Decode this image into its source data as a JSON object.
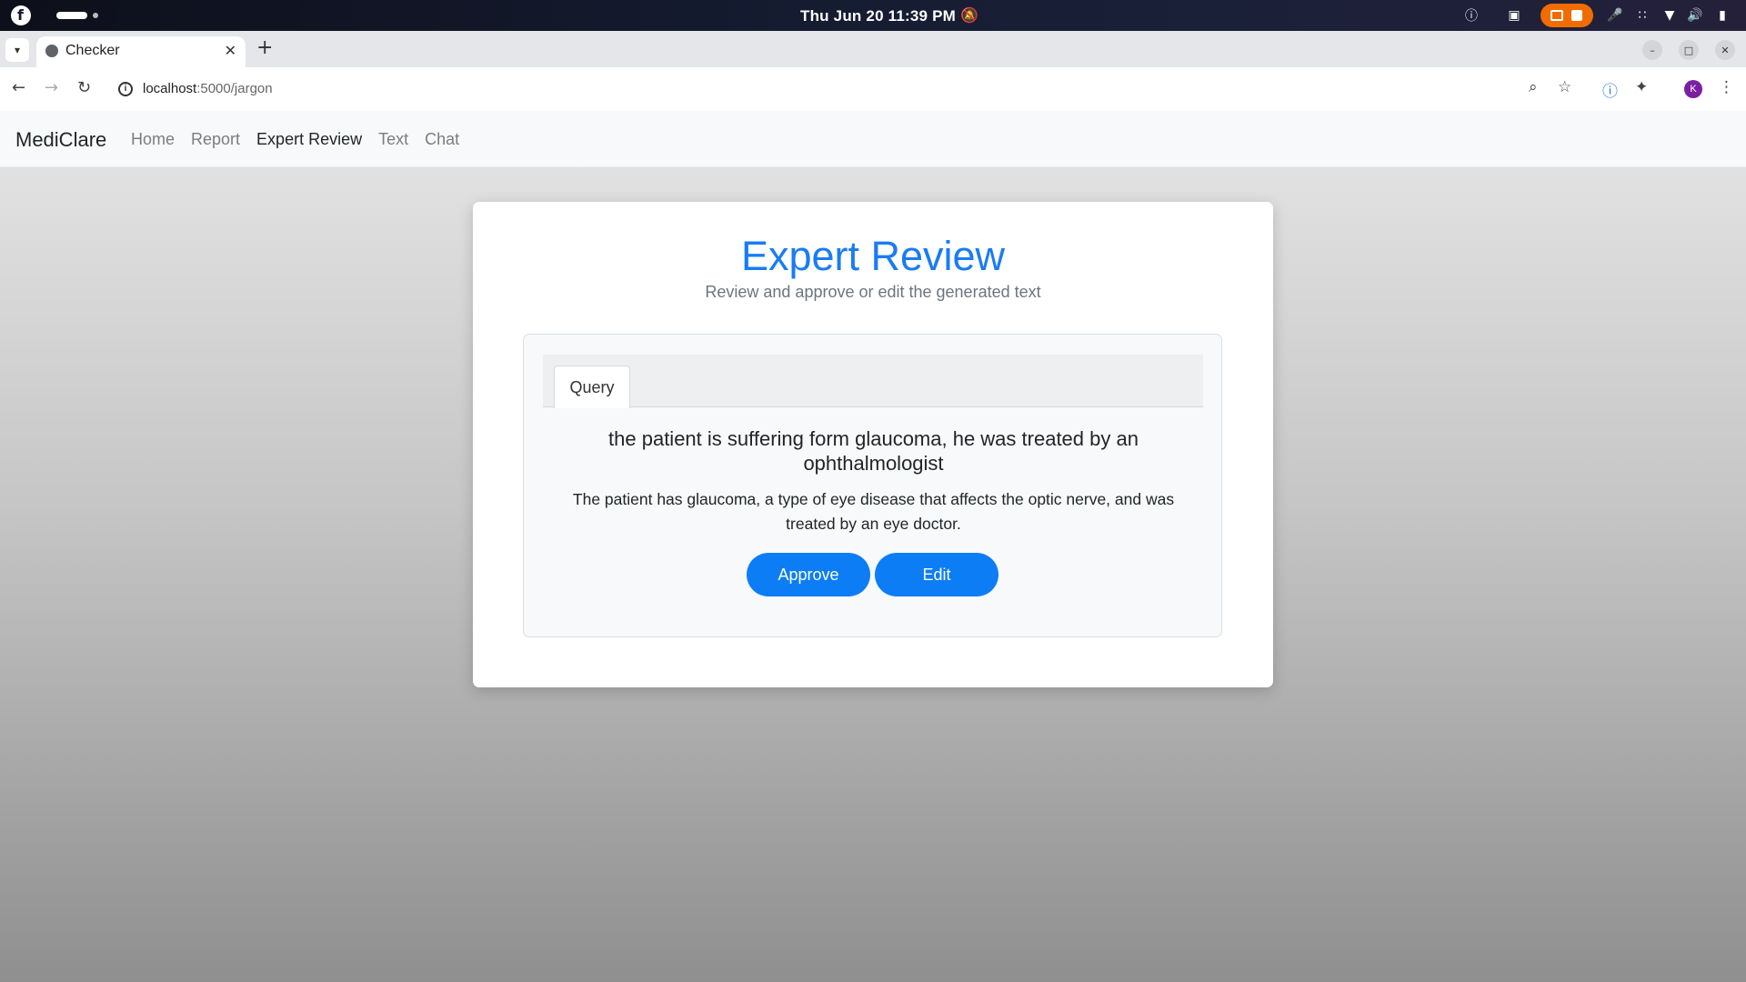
{
  "os": {
    "clock": "Thu Jun 20  11:39 PM"
  },
  "browser": {
    "tab_title": "Checker",
    "url_host": "localhost",
    "url_path": ":5000/jargon",
    "profile_initial": "K"
  },
  "navbar": {
    "brand": "MediClare",
    "links": [
      {
        "label": "Home",
        "active": false
      },
      {
        "label": "Report",
        "active": false
      },
      {
        "label": "Expert Review",
        "active": true
      },
      {
        "label": "Text",
        "active": false
      },
      {
        "label": "Chat",
        "active": false
      }
    ]
  },
  "card": {
    "title": "Expert Review",
    "subtitle": "Review and approve or edit the generated text",
    "tab_label": "Query",
    "query": "the patient is suffering form glaucoma, he was treated by an ophthalmologist",
    "result": "The patient has glaucoma, a type of eye disease that affects the optic nerve, and was treated by an eye doctor.",
    "approve_label": "Approve",
    "edit_label": "Edit"
  },
  "colors": {
    "accent": "#0d7df5",
    "title": "#1a7cf4",
    "recording": "#f06c00"
  }
}
